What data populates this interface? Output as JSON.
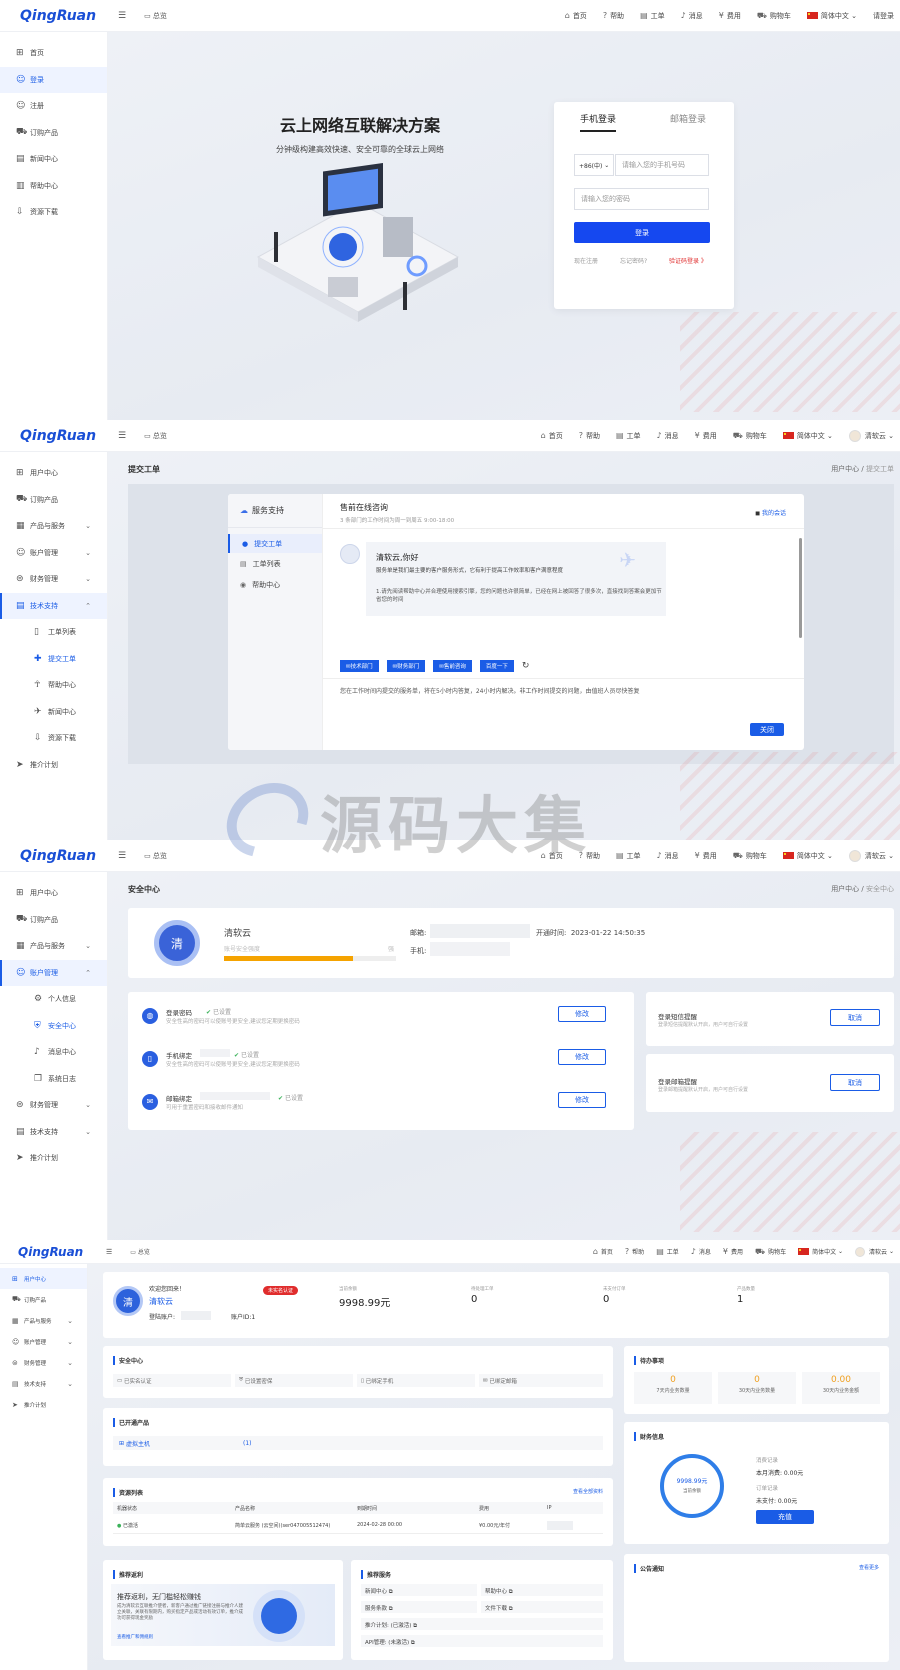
{
  "common": {
    "logo": "QingRuan",
    "overview": "总览",
    "nav": [
      "首页",
      "帮助",
      "工单",
      "消息",
      "费用",
      "购物车"
    ],
    "lang": "简体中文",
    "user": "清软云",
    "login_link": "请登录"
  },
  "s1": {
    "sidebar": [
      "首页",
      "登录",
      "注册",
      "订购产品",
      "新闻中心",
      "帮助中心",
      "资源下载"
    ],
    "hero_title": "云上网络互联解决方案",
    "hero_sub": "分钟级构建高效快速、安全可靠的全球云上网络",
    "login": {
      "tab_phone": "手机登录",
      "tab_email": "邮箱登录",
      "prefix": "+86(中)",
      "phone_ph": "请输入您的手机号码",
      "pwd_ph": "请输入您的密码",
      "submit": "登录",
      "register": "现在注册",
      "forgot": "忘记密码?",
      "code_login": "验证码登录 》"
    }
  },
  "s2": {
    "sidebar": [
      "用户中心",
      "订购产品",
      "产品与服务",
      "账户管理",
      "财务管理",
      "技术支持",
      "工单列表",
      "提交工单",
      "帮助中心",
      "新闻中心",
      "资源下载",
      "推介计划"
    ],
    "page_title": "提交工单",
    "crumb1": "用户中心",
    "crumb2": "提交工单",
    "panel_title": "服务支持",
    "menu": [
      "提交工单",
      "工单列表",
      "帮助中心"
    ],
    "chat_title": "售前在线咨询",
    "chat_hours": "3 条部门的工作时间为周一到周五 9:00-18:00",
    "my_orders": "我的会话",
    "bubble_title": "清软云,你好",
    "bubble_sub": "服务单是我们最主要的客户服务形式，它有利于提高工作效率和客户满意程度",
    "bubble_note": "1.请先阅读帮助中心并合理使用搜索引擎，您的问题也许很简单，已经在网上被回答了很多次，直接找到答案会更加节省您的时间",
    "dept": [
      "技术部门",
      "财务部门",
      "售前咨询",
      "百度一下"
    ],
    "reply_note": "您在工作时间内提交的服务单，将在5小时内答复，24小时内解决。非工作时间提交的问题，由值班人员尽快答复",
    "close": "关闭"
  },
  "s3": {
    "sidebar": [
      "用户中心",
      "订购产品",
      "产品与服务",
      "账户管理",
      "个人信息",
      "安全中心",
      "消息中心",
      "系统日志",
      "财务管理",
      "技术支持",
      "推介计划"
    ],
    "page_title": "安全中心",
    "crumb1": "用户中心",
    "crumb2": "安全中心",
    "avatar_char": "清",
    "name": "清软云",
    "strength_label": "账号安全强度",
    "strength_value": "强",
    "strength_pct": 75,
    "email_label": "邮箱:",
    "phone_label": "手机:",
    "open_time_label": "开通时间:",
    "open_time": "2023-01-22 14:50:35",
    "items": [
      {
        "title": "登录密码",
        "status": "已设置",
        "desc": "安全性高的密码可以使账号更安全,建议您定期更换密码",
        "btn": "修改"
      },
      {
        "title": "手机绑定",
        "status": "已设置",
        "desc": "安全性高的密码可以使账号更安全,建议您定期更换密码",
        "btn": "修改"
      },
      {
        "title": "邮箱绑定",
        "status": "已设置",
        "desc": "可用于重置密码和接收邮件通知",
        "btn": "修改"
      }
    ],
    "side_items": [
      {
        "title": "登录短信提醒",
        "desc": "登录短信提醒默认开启，用户可自行设置",
        "btn": "取消"
      },
      {
        "title": "登录邮箱提醒",
        "desc": "登录邮箱提醒默认开启，用户可自行设置",
        "btn": "取消"
      }
    ]
  },
  "s4": {
    "sidebar": [
      "用户中心",
      "订购产品",
      "产品与服务",
      "账户管理",
      "财务管理",
      "技术支持",
      "推介计划"
    ],
    "welcome": "欢迎您回来！",
    "name": "清软云",
    "badge": "未实名认证",
    "login_acct_label": "登陆账户:",
    "acct_id_label": "账户ID:1",
    "stats": [
      {
        "label": "当前余额",
        "value": "9998.99元"
      },
      {
        "label": "待处理工单",
        "value": "0"
      },
      {
        "label": "未支付订单",
        "value": "0"
      },
      {
        "label": "产品数量",
        "value": "1"
      }
    ],
    "security_title": "安全中心",
    "security": [
      "已实名认证",
      "已设置密保",
      "已绑定手机",
      "已绑定邮箱"
    ],
    "todo_title": "待办事项",
    "todo": [
      {
        "value": "0",
        "label": "7天内业务数量"
      },
      {
        "value": "0",
        "label": "30天内业务数量"
      },
      {
        "value": "0.00",
        "label": "30天内业务金额"
      }
    ],
    "opened_title": "已开通产品",
    "product": "虚拟主机",
    "product_count": "(1)",
    "finance_title": "财务信息",
    "ring_value": "9998.99元",
    "ring_label": "当前余额",
    "consume_title": "消费记录",
    "month_consume": "本月消费: 0.00元",
    "order_title": "订单记录",
    "unpaid": "未支付: 0.00元",
    "recharge": "充值",
    "res_title": "资源列表",
    "res_more": "查看全部资料",
    "res_cols": [
      "机器状态",
      "产品名称",
      "到期时间",
      "费用",
      "IP"
    ],
    "res_row": {
      "status": "已激活",
      "name": "简单云服务 (云空间)(ser047005512474)",
      "date": "2024-02-28 00:00",
      "fee": "¥0.00元/年付"
    },
    "notice_title": "公告通知",
    "notice_more": "查看更多",
    "promo_title": "推荐返利",
    "promo_head": "推荐返利，无门槛轻松赚钱",
    "promo_desc": "成为清软云互联推介使者，新客户通过推广链接注册与推介人建立关联，关联有限期内，购买指定产品或活动有效订单，推介成功可获得现金奖励",
    "promo_link": "查看推广和佣规则",
    "svc_title": "推荐服务",
    "svc": [
      "新闻中心",
      "帮助中心",
      "服务条款",
      "文件下载",
      "推介计划: (已激活)",
      "API管理: (未激活)"
    ]
  },
  "watermark": "源码大集"
}
